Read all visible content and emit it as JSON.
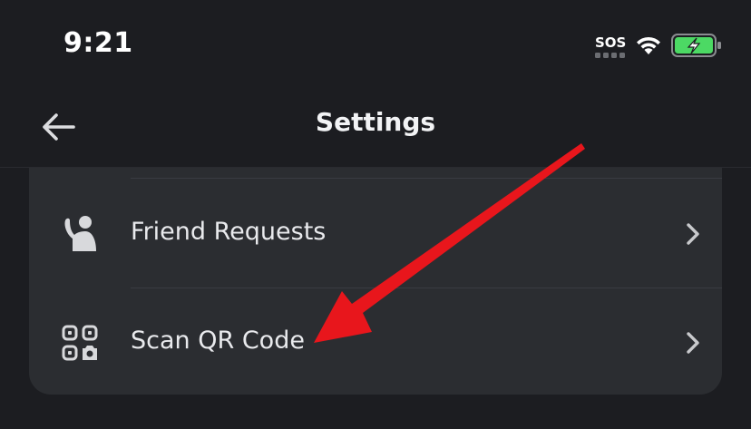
{
  "status_bar": {
    "time": "9:21",
    "sos": "SOS"
  },
  "nav": {
    "title": "Settings"
  },
  "rows": [
    {
      "label": "Friend Requests"
    },
    {
      "label": "Scan QR Code"
    }
  ],
  "colors": {
    "background": "#1c1d21",
    "card": "#2b2d31",
    "annotation_arrow": "#e8161c",
    "battery_fill": "#4cd964"
  },
  "icons": {
    "back": "arrow-left-icon",
    "friend_requests": "person-wave-icon",
    "scan_qr": "qr-scan-icon",
    "chevron": "chevron-right-icon"
  }
}
